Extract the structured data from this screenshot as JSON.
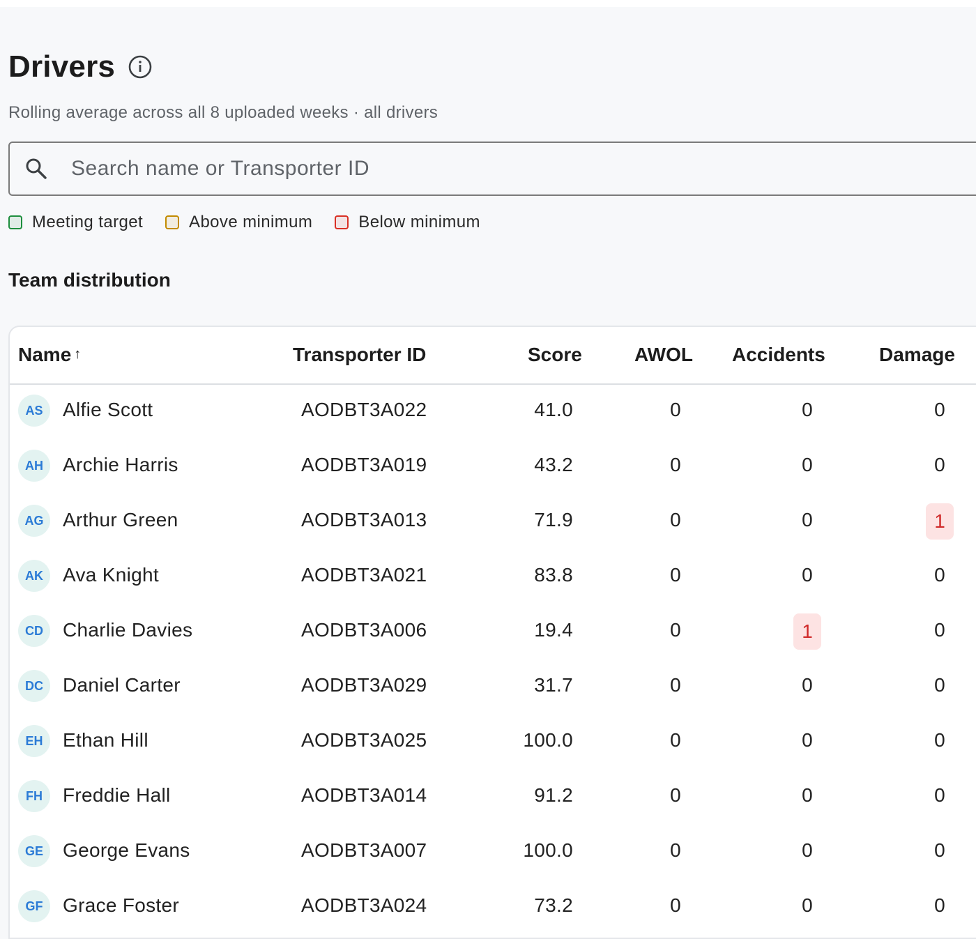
{
  "header": {
    "title": "Drivers",
    "subtitle": "Rolling average across all 8 uploaded weeks · all drivers"
  },
  "search": {
    "placeholder": "Search name or Transporter ID",
    "value": ""
  },
  "legend": [
    {
      "label": "Meeting target",
      "color": "#1e8e3e"
    },
    {
      "label": "Above minimum",
      "color": "#c28b00"
    },
    {
      "label": "Below minimum",
      "color": "#d93025"
    }
  ],
  "section": {
    "title": "Team distribution"
  },
  "table": {
    "columns": {
      "name": "Name",
      "transporter_id": "Transporter ID",
      "score": "Score",
      "awol": "AWOL",
      "accidents": "Accidents",
      "damage": "Damage"
    },
    "sort": {
      "column": "name",
      "direction": "ascending",
      "indicator": "↑"
    },
    "rows": [
      {
        "initials": "AS",
        "name": "Alfie Scott",
        "transporter_id": "AODBT3A022",
        "score": "41.0",
        "awol": "0",
        "accidents": "0",
        "damage": "0"
      },
      {
        "initials": "AH",
        "name": "Archie Harris",
        "transporter_id": "AODBT3A019",
        "score": "43.2",
        "awol": "0",
        "accidents": "0",
        "damage": "0"
      },
      {
        "initials": "AG",
        "name": "Arthur Green",
        "transporter_id": "AODBT3A013",
        "score": "71.9",
        "awol": "0",
        "accidents": "0",
        "damage": "1"
      },
      {
        "initials": "AK",
        "name": "Ava Knight",
        "transporter_id": "AODBT3A021",
        "score": "83.8",
        "awol": "0",
        "accidents": "0",
        "damage": "0"
      },
      {
        "initials": "CD",
        "name": "Charlie Davies",
        "transporter_id": "AODBT3A006",
        "score": "19.4",
        "awol": "0",
        "accidents": "1",
        "damage": "0"
      },
      {
        "initials": "DC",
        "name": "Daniel Carter",
        "transporter_id": "AODBT3A029",
        "score": "31.7",
        "awol": "0",
        "accidents": "0",
        "damage": "0"
      },
      {
        "initials": "EH",
        "name": "Ethan Hill",
        "transporter_id": "AODBT3A025",
        "score": "100.0",
        "awol": "0",
        "accidents": "0",
        "damage": "0"
      },
      {
        "initials": "FH",
        "name": "Freddie Hall",
        "transporter_id": "AODBT3A014",
        "score": "91.2",
        "awol": "0",
        "accidents": "0",
        "damage": "0"
      },
      {
        "initials": "GE",
        "name": "George Evans",
        "transporter_id": "AODBT3A007",
        "score": "100.0",
        "awol": "0",
        "accidents": "0",
        "damage": "0"
      },
      {
        "initials": "GF",
        "name": "Grace Foster",
        "transporter_id": "AODBT3A024",
        "score": "73.2",
        "awol": "0",
        "accidents": "0",
        "damage": "0"
      }
    ]
  }
}
